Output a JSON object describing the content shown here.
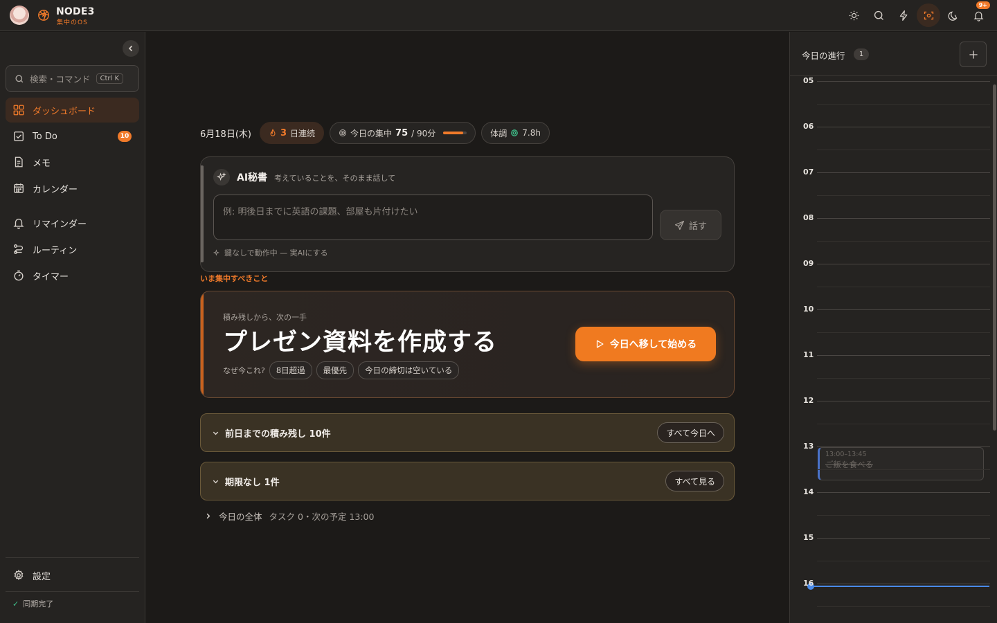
{
  "brand": {
    "name": "NODE3",
    "tagline": "集中のOS"
  },
  "topbar": {
    "notif_badge": "9+"
  },
  "sidebar": {
    "search_placeholder": "検索・コマンド",
    "search_shortcut": "Ctrl K",
    "items": [
      {
        "label": "ダッシュボード"
      },
      {
        "label": "To Do",
        "badge": "10"
      },
      {
        "label": "メモ"
      },
      {
        "label": "カレンダー"
      },
      {
        "label": "リマインダー"
      },
      {
        "label": "ルーティン"
      },
      {
        "label": "タイマー"
      }
    ],
    "settings_label": "設定",
    "sync_status": "同期完了"
  },
  "status": {
    "date": "6月18日(木)",
    "streak_num": "3",
    "streak_label": "日連続",
    "focus_label": "今日の集中",
    "focus_value": "75",
    "focus_goal": "/ 90分",
    "focus_progress": 0.83,
    "health_label": "体調",
    "health_value": "7.8h"
  },
  "ai": {
    "title": "AI秘書",
    "subtitle": "考えていることを、そのまま話して",
    "input_placeholder": "例: 明後日までに英語の課題、部屋も片付けたい",
    "talk_label": "話す",
    "note": "鍵なしで動作中 — 実AIにする"
  },
  "focus": {
    "section_label": "いま集中すべきこと",
    "kicker": "積み残しから、次の一手",
    "title": "プレゼン資料を作成する",
    "why_label": "なぜ今これ?",
    "reasons": [
      "8日超過",
      "最優先",
      "今日の締切は空いている"
    ],
    "start_label": "今日へ移して始める"
  },
  "accordions": [
    {
      "label": "前日までの積み残し 10件",
      "button": "すべて今日へ"
    },
    {
      "label": "期限なし 1件",
      "button": "すべて見る"
    }
  ],
  "overview": {
    "label": "今日の全体",
    "meta": "タスク 0・次の予定 13:00"
  },
  "right_panel": {
    "title": "今日の進行",
    "count": "1",
    "hours": [
      "05",
      "06",
      "07",
      "08",
      "09",
      "10",
      "11",
      "12",
      "13",
      "14",
      "15",
      "16"
    ],
    "event": {
      "time": "13:00–13:45",
      "title": "ご飯を食べる"
    }
  },
  "colors": {
    "accent": "#f07a20",
    "now_line": "#4a8ae8",
    "sync_ok": "#3fbf8a"
  }
}
